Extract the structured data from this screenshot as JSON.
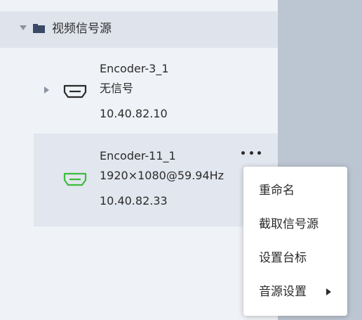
{
  "tree": {
    "group": {
      "title": "视频信号源",
      "icons": {
        "expand": "caret-down-icon",
        "folder": "folder-icon"
      }
    },
    "items": [
      {
        "name": "Encoder-3_1",
        "signal": "无信号",
        "ip": "10.40.82.10",
        "icon": "hdmi-port-icon",
        "expand_icon": "caret-right-icon",
        "status_color": "#2b2b2b"
      },
      {
        "name": "Encoder-11_1",
        "signal": "1920×1080@59.94Hz",
        "ip": "10.40.82.33",
        "icon": "hdmi-port-icon",
        "more_icon": "more-dots-icon",
        "status_color": "#3dbb3d"
      }
    ]
  },
  "context_menu": {
    "items": [
      {
        "label": "重命名"
      },
      {
        "label": "截取信号源"
      },
      {
        "label": "设置台标"
      },
      {
        "label": "音源设置",
        "submenu_icon": "caret-right-icon"
      }
    ]
  },
  "colors": {
    "panel_bg": "#eff2f6",
    "header_bg": "#dfe4ec",
    "selected_bg": "#e2e6ee",
    "right_strip": "#bcc5d2",
    "signal_ok": "#3dbb3d"
  }
}
